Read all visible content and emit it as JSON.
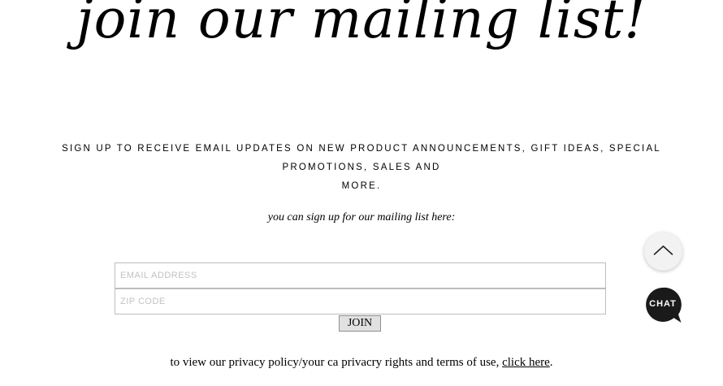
{
  "heading": "join our mailing list!",
  "intro_line_1": "SIGN UP TO RECEIVE EMAIL UPDATES ON NEW PRODUCT ANNOUNCEMENTS, GIFT IDEAS, SPECIAL PROMOTIONS, SALES AND",
  "intro_line_2": "MORE.",
  "subheading": "you can sign up for our mailing list here:",
  "form": {
    "email_placeholder": "EMAIL ADDRESS",
    "email_value": "",
    "zip_placeholder": "ZIP CODE",
    "zip_value": "",
    "join_label": "JOIN"
  },
  "privacy": {
    "text": "to view our privacy policy/your ca privacry rights and terms of use, ",
    "link_text": "click here",
    "trailing": "."
  },
  "widgets": {
    "scroll_top_icon": "chevron-up-icon",
    "chat_label": "CHAT",
    "chat_color": "#1a1a1a"
  }
}
